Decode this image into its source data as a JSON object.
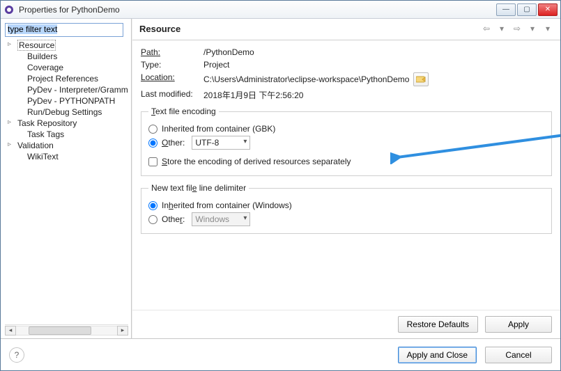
{
  "window": {
    "title": "Properties for PythonDemo"
  },
  "sidebar": {
    "filter_placeholder": "type filter text",
    "items": [
      {
        "label": "Resource",
        "expandable": true,
        "selected": true
      },
      {
        "label": "Builders"
      },
      {
        "label": "Coverage"
      },
      {
        "label": "Project References"
      },
      {
        "label": "PyDev - Interpreter/Grammar"
      },
      {
        "label": "PyDev - PYTHONPATH"
      },
      {
        "label": "Run/Debug Settings"
      },
      {
        "label": "Task Repository",
        "expandable": true
      },
      {
        "label": "Task Tags"
      },
      {
        "label": "Validation",
        "expandable": true
      },
      {
        "label": "WikiText"
      }
    ]
  },
  "header": {
    "title": "Resource"
  },
  "details": {
    "path_label": "Path:",
    "path_value": "/PythonDemo",
    "type_label": "Type:",
    "type_value": "Project",
    "location_label": "Location:",
    "location_value": "C:\\Users\\Administrator\\eclipse-workspace\\PythonDemo",
    "modified_label": "Last modified:",
    "modified_value": "2018年1月9日 下午2:56:20"
  },
  "encoding": {
    "legend": "Text file encoding",
    "inherited_label": "Inherited from container (GBK)",
    "other_label": "Other:",
    "other_value": "UTF-8",
    "store_label": "Store the encoding of derived resources separately"
  },
  "delimiter": {
    "legend": "New text file line delimiter",
    "inherited_label": "Inherited from container (Windows)",
    "other_label": "Other:",
    "other_value": "Windows"
  },
  "buttons": {
    "restore": "Restore Defaults",
    "apply": "Apply",
    "apply_close": "Apply and Close",
    "cancel": "Cancel"
  }
}
